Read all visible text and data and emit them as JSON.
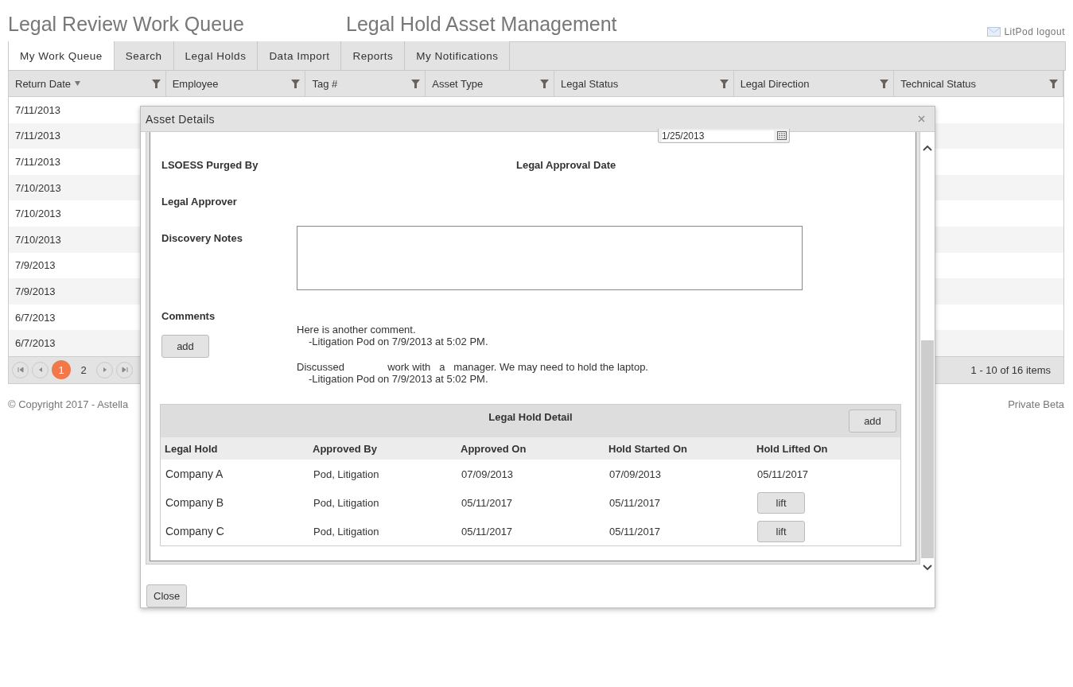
{
  "header": {
    "title": "Legal Review Work Queue",
    "subtitle": "Legal Hold Asset Management",
    "user_link": "LitPod logout"
  },
  "tabs": [
    {
      "label": "My Work Queue",
      "selected": true
    },
    {
      "label": "Search",
      "selected": false
    },
    {
      "label": "Legal Holds",
      "selected": false
    },
    {
      "label": "Data Import",
      "selected": false
    },
    {
      "label": "Reports",
      "selected": false
    },
    {
      "label": "My Notifications",
      "selected": false
    }
  ],
  "grid": {
    "columns": [
      {
        "label": "Return Date",
        "sorted": true
      },
      {
        "label": "Employee",
        "sorted": false
      },
      {
        "label": "Tag #",
        "sorted": false
      },
      {
        "label": "Asset Type",
        "sorted": false
      },
      {
        "label": "Legal Status",
        "sorted": false
      },
      {
        "label": "Legal Direction",
        "sorted": false
      },
      {
        "label": "Technical Status",
        "sorted": false
      }
    ],
    "rows": [
      {
        "return_date": "7/11/2013"
      },
      {
        "return_date": "7/11/2013"
      },
      {
        "return_date": "7/11/2013"
      },
      {
        "return_date": "7/10/2013"
      },
      {
        "return_date": "7/10/2013"
      },
      {
        "return_date": "7/10/2013"
      },
      {
        "return_date": "7/9/2013"
      },
      {
        "return_date": "7/9/2013"
      },
      {
        "return_date": "6/7/2013"
      },
      {
        "return_date": "6/7/2013"
      }
    ],
    "pages": [
      {
        "label": "1",
        "selected": true
      },
      {
        "label": "2",
        "selected": false
      }
    ],
    "summary": "1 - 10 of 16 items"
  },
  "footer": {
    "copyright": "© Copyright 2017 - Astella",
    "note": "Private Beta"
  },
  "modal": {
    "title": "Asset Details",
    "date_value": "1/25/2013",
    "fields": [
      {
        "left": "LSOESS Purged By",
        "right": "Legal Approval Date"
      },
      {
        "left": "Legal Approver"
      }
    ],
    "notes_label": "Discovery Notes",
    "comments": {
      "label": "Comments",
      "add": "add",
      "items": [
        {
          "text": "Here is another comment.",
          "author": "-Litigation Pod on 7/9/2013 at 5:02 PM."
        },
        {
          "text": "Discussed               work with   a   manager. We may need to hold the laptop.",
          "author": "-Litigation Pod on 7/9/2013 at 5:02 PM."
        }
      ]
    },
    "hold_detail": {
      "title": "Legal Hold Detail",
      "add": "add",
      "columns": [
        "Legal Hold",
        "Approved By",
        "Approved On",
        "Hold Started On",
        "Hold Lifted On"
      ],
      "rows": [
        {
          "legal_hold": "Company A",
          "approved_by": "Pod, Litigation",
          "approved_on": "07/09/2013",
          "hold_started_on": "07/09/2013",
          "lifted": {
            "kind": "date",
            "text": "05/11/2017"
          }
        },
        {
          "legal_hold": "Company B",
          "approved_by": "Pod, Litigation",
          "approved_on": "05/11/2017",
          "hold_started_on": "05/11/2017",
          "lifted": {
            "kind": "button",
            "text": "lift"
          }
        },
        {
          "legal_hold": "Company C",
          "approved_by": "Pod, Litigation",
          "approved_on": "05/11/2017",
          "hold_started_on": "05/11/2017",
          "lifted": {
            "kind": "button",
            "text": "lift"
          }
        }
      ]
    },
    "close": "Close"
  }
}
